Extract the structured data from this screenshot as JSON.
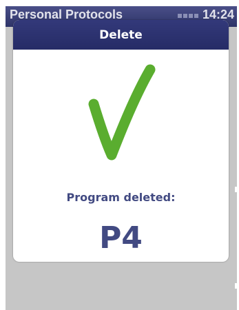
{
  "statusbar": {
    "title": "Personal Protocols",
    "time": "14:24"
  },
  "dialog": {
    "title": "Delete",
    "message": "Program deleted:",
    "program": "P4",
    "icon": "checkmark-icon",
    "accent_color": "#5aad2f",
    "header_color": "#2b3170",
    "text_color": "#424a82"
  }
}
